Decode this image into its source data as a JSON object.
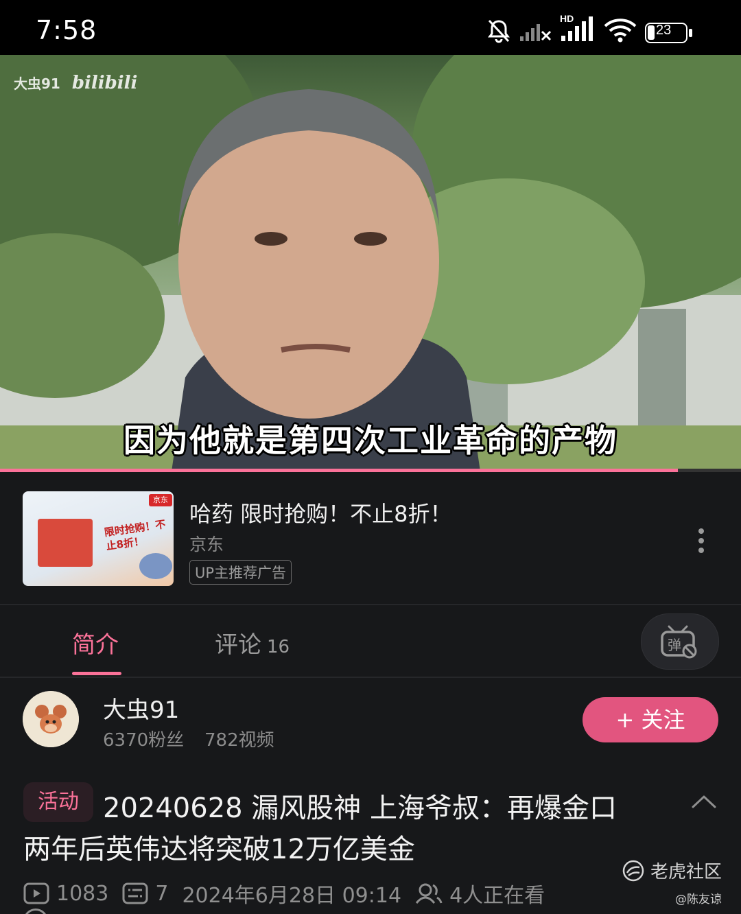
{
  "status_bar": {
    "time": "7:58",
    "battery": "23"
  },
  "video": {
    "watermark_user": "大虫91",
    "watermark_logo": "bilibili",
    "subtitle": "因为他就是第四次工业革命的产物",
    "progress": 0.915
  },
  "ad": {
    "thumb_headline": "限时抢购！不止8折！",
    "thumb_brand": "京东",
    "title": "哈药 限时抢购！不止8折！",
    "source": "京东",
    "badge": "UP主推荐广告"
  },
  "tabs": {
    "intro_label": "简介",
    "comments_label": "评论",
    "comments_count": "16",
    "danmaku_icon": "danmaku-off-icon"
  },
  "uploader": {
    "name": "大虫91",
    "fans": "6370粉丝",
    "videos": "782视频",
    "follow_label": "+ 关注"
  },
  "video_info": {
    "tag": "活动",
    "title_line1": "20240628 漏风股神 上海爷叔：再爆金口",
    "title_line2": "两年后英伟达将突破12万亿美金",
    "views": "1083",
    "danmaku": "7",
    "date": "2024年6月28日 09:14",
    "watching": "4人正在看"
  },
  "watermark": {
    "brand": "老虎社区",
    "user": "@陈友谅"
  },
  "colors": {
    "accent": "#fb7299",
    "follow_bg": "#e2557f",
    "background": "#17181a"
  }
}
